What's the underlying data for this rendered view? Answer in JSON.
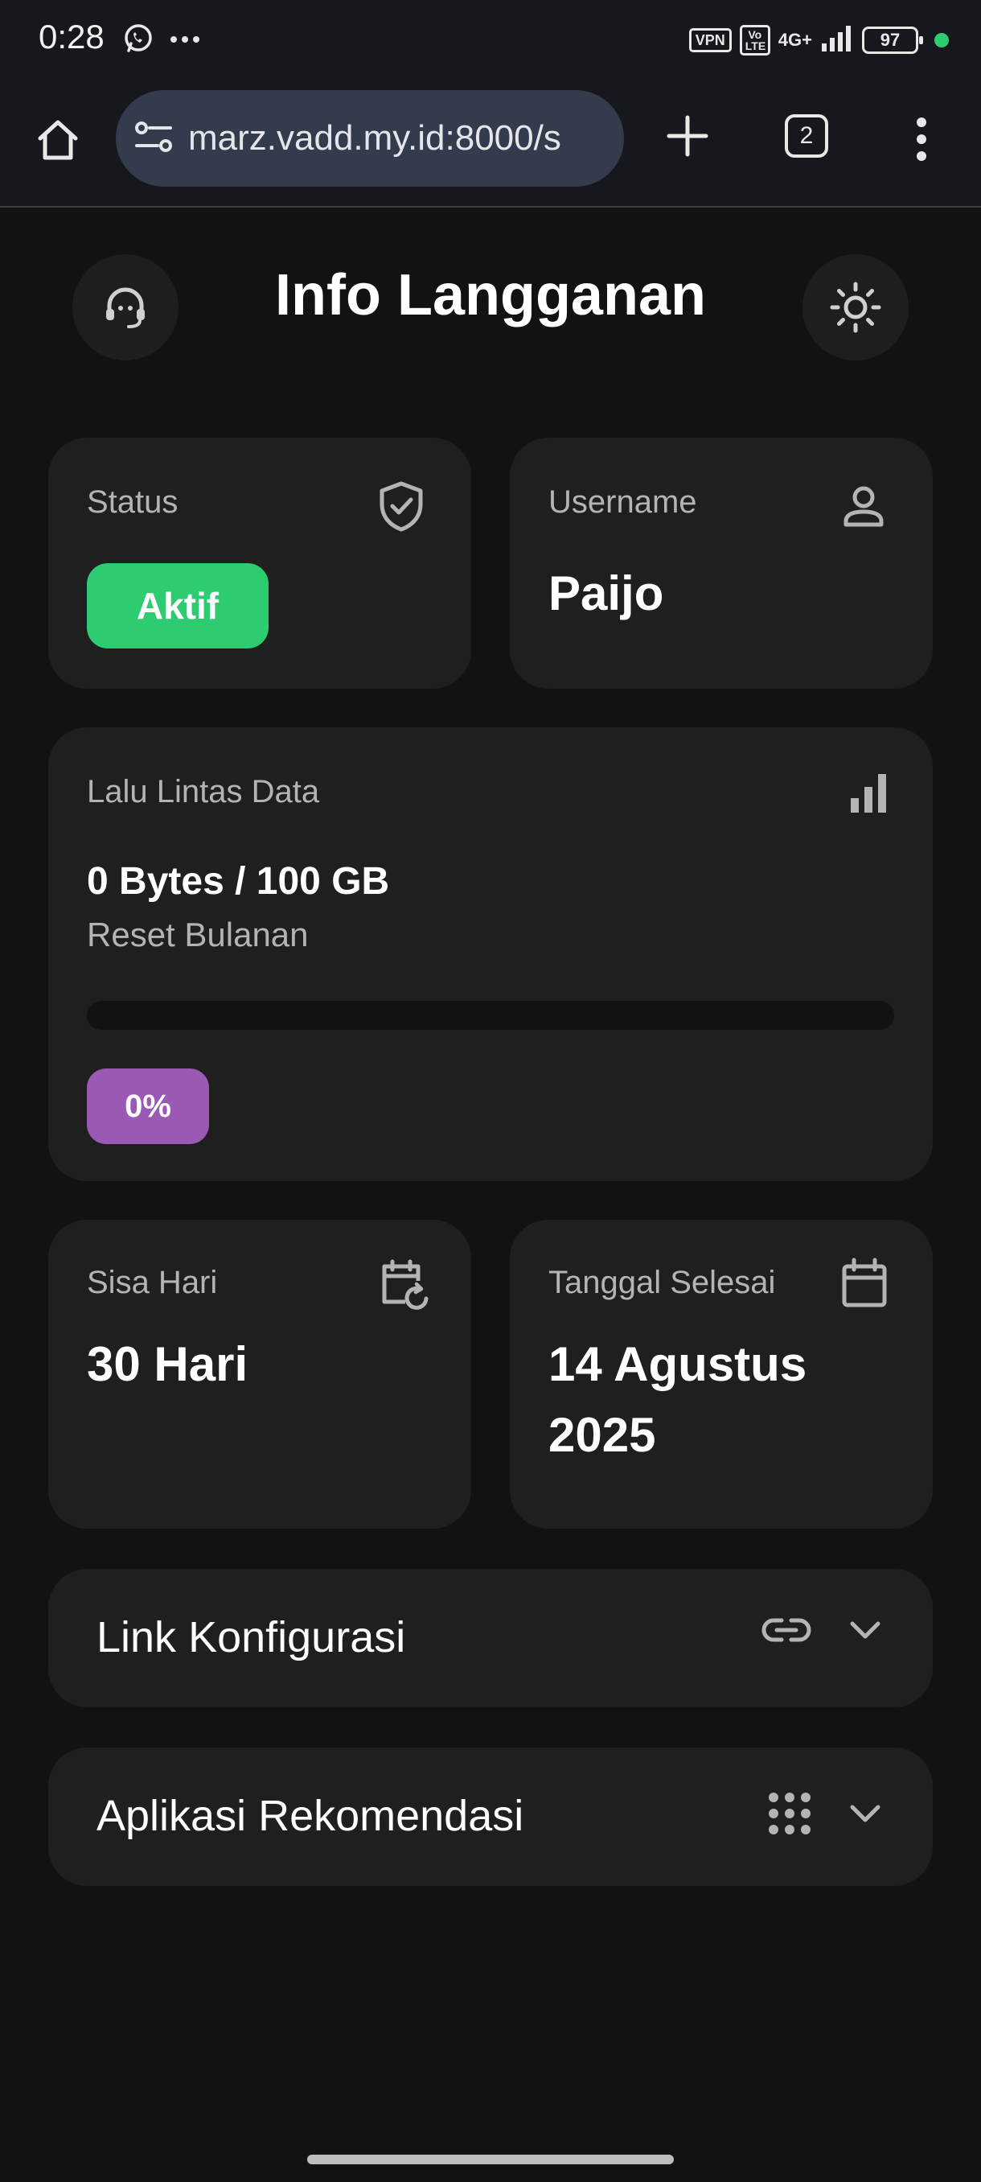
{
  "status_bar": {
    "time": "0:28",
    "vpn_label": "VPN",
    "volte_label": "Vo LTE",
    "network_label": "4G+",
    "battery_level": "97",
    "icons": [
      "whatsapp-icon",
      "more-notifications-icon",
      "signal-icon"
    ]
  },
  "browser": {
    "url": "marz.vadd.my.id:8000/s",
    "tab_count": "2",
    "icons": [
      "home-icon",
      "site-settings-icon",
      "new-tab-icon",
      "tabs-icon",
      "overflow-menu-icon"
    ]
  },
  "header": {
    "title": "Info Langganan",
    "left_icon": "support-agent-icon",
    "right_icon": "sun-theme-icon"
  },
  "status_card": {
    "label": "Status",
    "value": "Aktif",
    "icon": "shield-check-icon",
    "badge_color": "#2ecc71"
  },
  "username_card": {
    "label": "Username",
    "value": "Paijo",
    "icon": "user-icon"
  },
  "traffic_card": {
    "label": "Lalu Lintas Data",
    "amount": "0 Bytes / 100 GB",
    "reset": "Reset Bulanan",
    "progress_fraction": 0,
    "percent": "0%",
    "icon": "bar-chart-icon",
    "accent_color": "#9b59b6"
  },
  "days_card": {
    "label": "Sisa Hari",
    "value": "30 Hari",
    "icon": "calendar-refresh-icon"
  },
  "end_date_card": {
    "label": "Tanggal Selesai",
    "value_line1": "14 Agustus",
    "value_line2": "2025",
    "icon": "calendar-icon"
  },
  "accordions": [
    {
      "title": "Link Konfigurasi",
      "icon": "link-icon"
    },
    {
      "title": "Aplikasi Rekomendasi",
      "icon": "apps-grid-icon"
    }
  ],
  "colors": {
    "background": "#121212",
    "card": "#1f1f1f",
    "status_green": "#2ecc71",
    "progress_purple": "#9b59b6"
  }
}
